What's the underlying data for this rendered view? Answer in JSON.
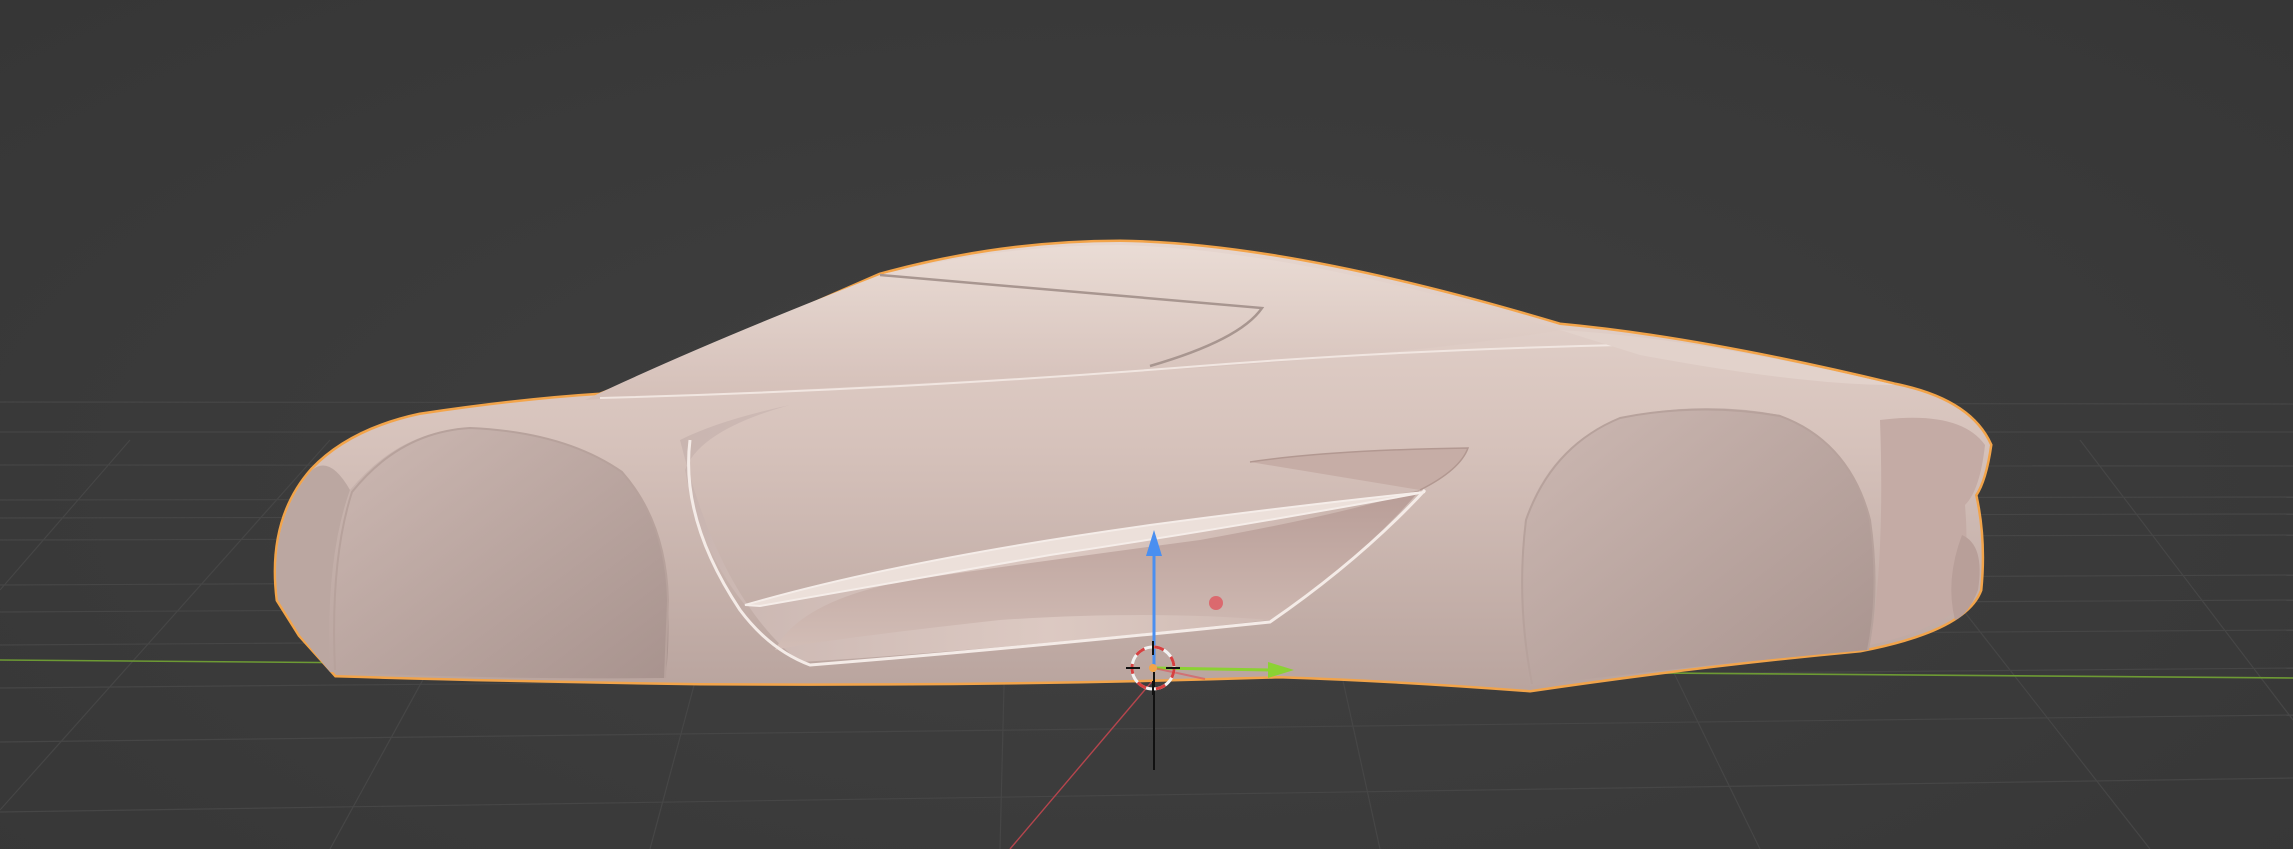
{
  "viewport": {
    "mode": "3d-viewport",
    "background_color": "#393939",
    "grid_line_color": "#464646",
    "x_axis_color": "#b5454d",
    "y_axis_color": "#6d9a34",
    "selection_outline_color": "#f2a44a",
    "model_body_color": "#d7c1ba"
  },
  "selected_object": {
    "kind": "car-body-mesh",
    "selected": true
  },
  "gizmo": {
    "z_arrow_color": "#4a8ff0",
    "y_arrow_color": "#8bd233",
    "x_arrow_color": "#e0505a",
    "icons": [
      "3d-cursor-icon",
      "z-axis-arrow-icon",
      "y-axis-arrow-icon",
      "x-axis-handle-icon"
    ]
  }
}
